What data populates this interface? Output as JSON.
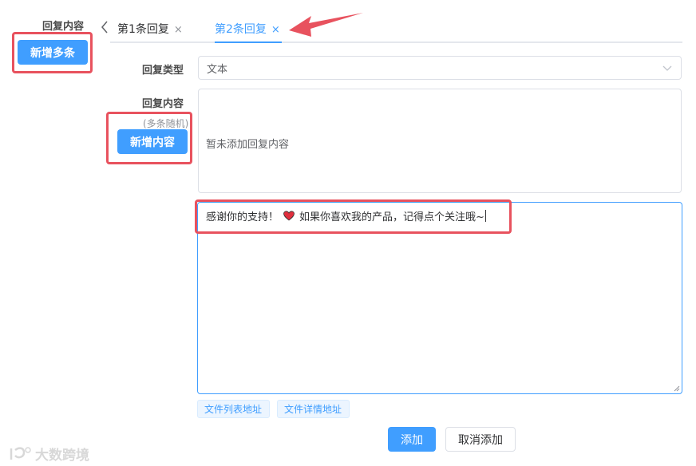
{
  "section": {
    "label": "回复内容",
    "add_multi_label": "新增多条"
  },
  "tabs": [
    {
      "label": "第1条回复",
      "close": "×",
      "active": false
    },
    {
      "label": "第2条回复",
      "close": "×",
      "active": true
    }
  ],
  "tabs_nav": {
    "prev_icon": "chevron-left-icon"
  },
  "form": {
    "type_label": "回复类型",
    "type_value": "文本",
    "content_label": "回复内容",
    "content_hint": "(多条随机)",
    "add_content_label": "新增内容",
    "empty_text": "暂未添加回复内容",
    "textarea_text_before": "感谢你的支持！",
    "textarea_emoji": "heart-icon",
    "textarea_text_after": "如果你喜欢我的产品，记得点个关注哦~",
    "link_buttons": [
      "文件列表地址",
      "文件详情地址"
    ],
    "submit_label": "添加",
    "cancel_label": "取消添加"
  },
  "watermark": {
    "text": "大数跨境"
  },
  "colors": {
    "primary": "#409eff",
    "annotation": "#e8525e",
    "border": "#dcdfe6"
  }
}
